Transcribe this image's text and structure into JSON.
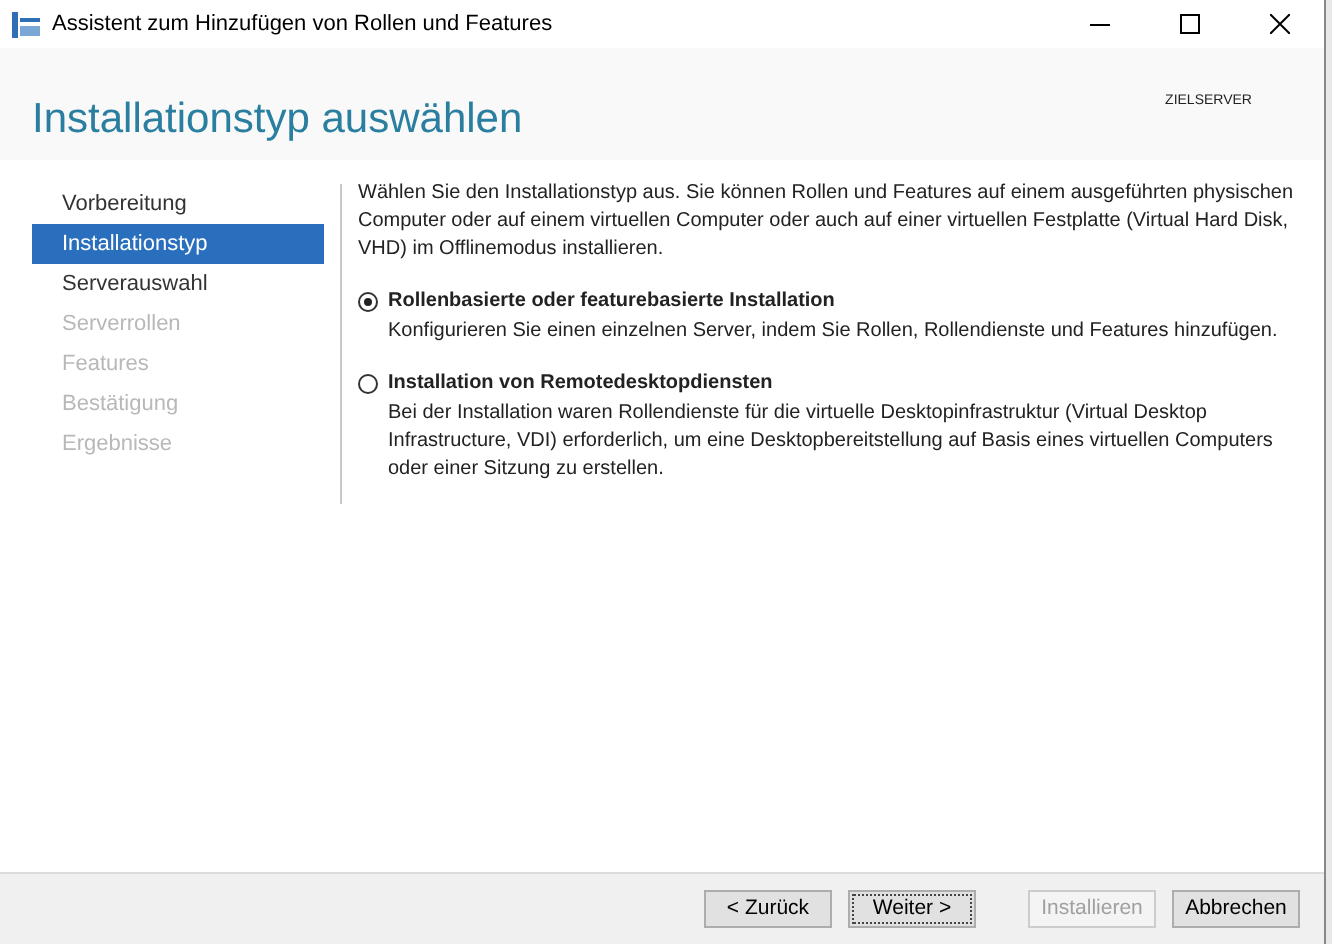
{
  "window": {
    "title": "Assistent zum Hinzufügen von Rollen und Features"
  },
  "header": {
    "title": "Installationstyp auswählen",
    "target_label": "ZIELSERVER"
  },
  "sidebar": {
    "items": [
      {
        "label": "Vorbereitung",
        "selected": false,
        "disabled": false
      },
      {
        "label": "Installationstyp",
        "selected": true,
        "disabled": false
      },
      {
        "label": "Serverauswahl",
        "selected": false,
        "disabled": false
      },
      {
        "label": "Serverrollen",
        "selected": false,
        "disabled": true
      },
      {
        "label": "Features",
        "selected": false,
        "disabled": true
      },
      {
        "label": "Bestätigung",
        "selected": false,
        "disabled": true
      },
      {
        "label": "Ergebnisse",
        "selected": false,
        "disabled": true
      }
    ]
  },
  "content": {
    "intro": "Wählen Sie den Installationstyp aus. Sie können Rollen und Features auf einem ausgeführten physischen Computer oder auf einem virtuellen Computer oder auch auf einer virtuellen Festplatte (Virtual Hard Disk, VHD) im Offlinemodus installieren.",
    "options": [
      {
        "label": "Rollenbasierte oder featurebasierte Installation",
        "description": "Konfigurieren Sie einen einzelnen Server, indem Sie Rollen, Rollendienste und Features hinzufügen.",
        "selected": true
      },
      {
        "label": "Installation von Remotedesktopdiensten",
        "description": "Bei der Installation waren Rollendienste für die virtuelle Desktopinfrastruktur (Virtual Desktop Infrastructure, VDI) erforderlich, um eine Desktopbereitstellung auf Basis eines virtuellen Computers oder einer Sitzung zu erstellen.",
        "selected": false
      }
    ]
  },
  "buttons": [
    {
      "label": "< Zurück",
      "disabled": false,
      "focused": false
    },
    {
      "label": "Weiter >",
      "disabled": false,
      "focused": true
    },
    {
      "label": "Installieren",
      "disabled": true,
      "focused": false
    },
    {
      "label": "Abbrechen",
      "disabled": false,
      "focused": false
    }
  ]
}
